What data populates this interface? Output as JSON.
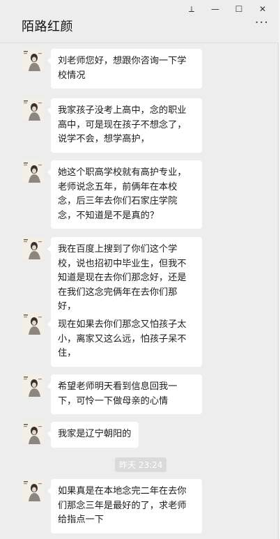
{
  "window": {
    "title": "陌路红颜",
    "controls": {
      "pin": "⟂",
      "minimize": "—",
      "maximize": "☐",
      "close": "✕"
    },
    "more": "···"
  },
  "messages": [
    {
      "text": "刘老师您好，想跟你咨询一下学校情况"
    },
    {
      "text": "我家孩子没考上高中，念的职业高中，可是现在孩子不想念了，说学不会，想学高护，"
    },
    {
      "text": "她这个职高学校就有高护专业，老师说念五年，前俩年在本校念，后三年去你们石家庄学院念，不知道是不是真的？"
    },
    {
      "text": "我在百度上搜到了你们这个学校，说也招初中毕业生，但我不知道是现在去你们那念好，还是在我们这念完俩年在去你们那好，"
    },
    {
      "text": "现在如果去你们那念又怕孩子太小，离家又这么远，怕孩子呆不住，"
    },
    {
      "text": "希望老师明天看到信息回我一下，可怜一下做母亲的心情"
    },
    {
      "text": "我家是辽宁朝阳的"
    },
    {
      "text": "如果真是在本地念完二年在去你们那念三年是最好的了，求老师给指点一下"
    }
  ],
  "timestamp": "昨天 23:24"
}
